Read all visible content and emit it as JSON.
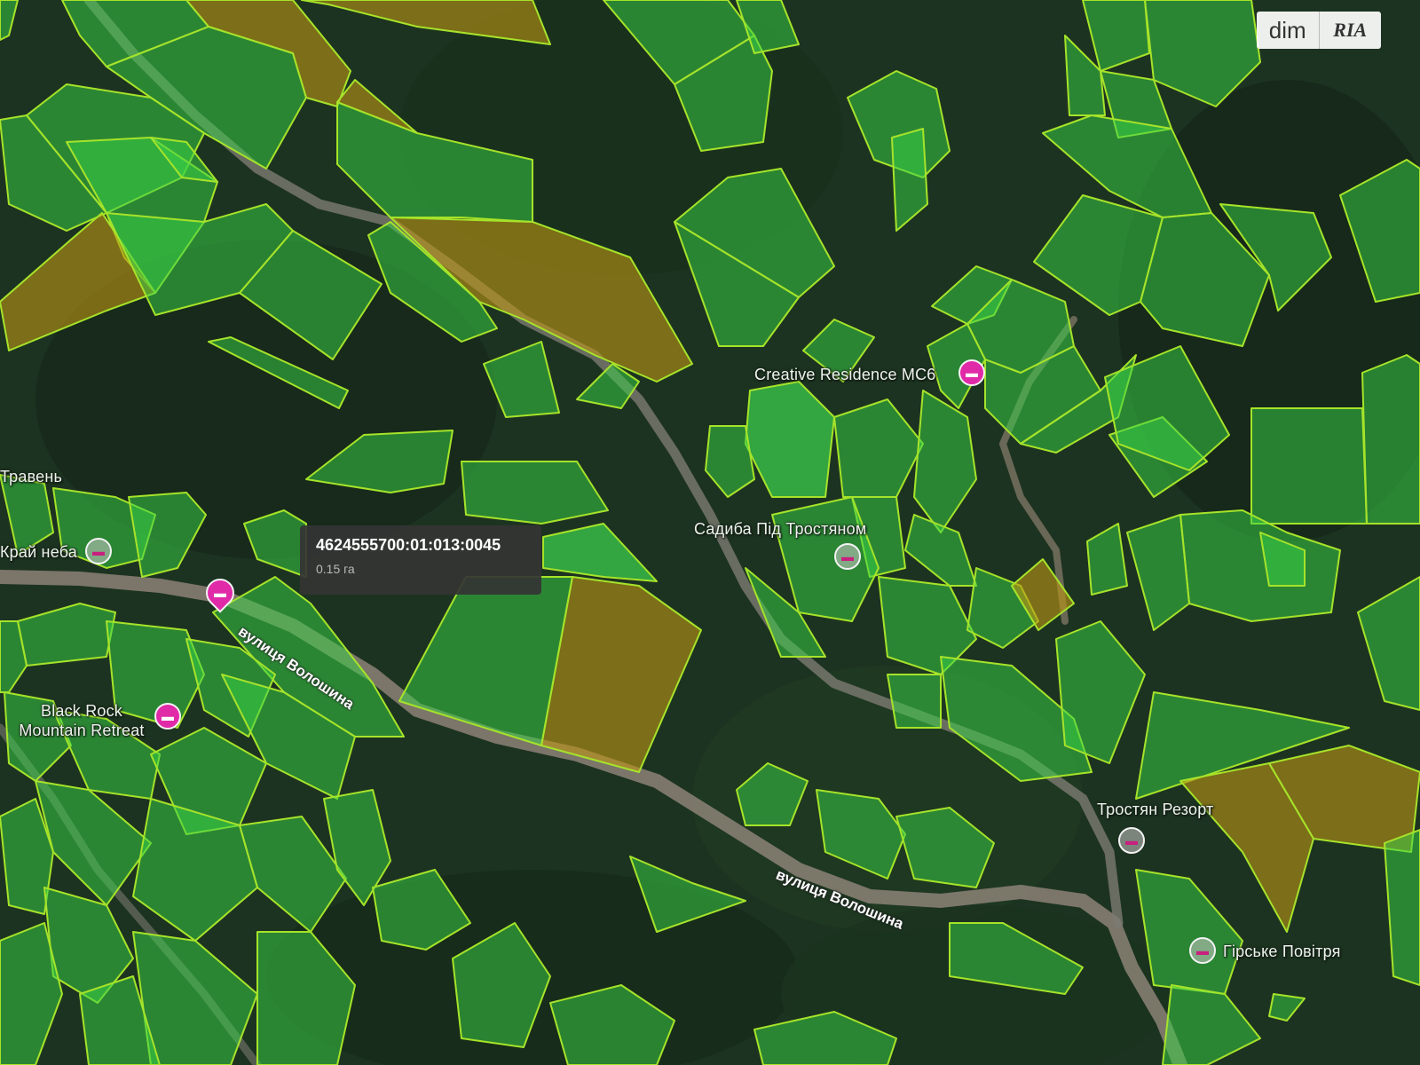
{
  "map": {
    "places": {
      "travnen": "Травень",
      "krai_neba": "Край неба",
      "black_rock": "Black Rock Mountain Retreat",
      "creative_residence": "Creative Residence MC6",
      "sadyba": "Садиба Під Тростяном",
      "trostian_resort": "Тростян Резорт",
      "hirske_povitria": "Гірське Повітря"
    },
    "streets": {
      "voloshyna_1": "вулиця Волошина",
      "voloshyna_2": "вулиця Волошина"
    },
    "icons": {
      "hotel": "hotel-bed-icon",
      "pin": "map-pin-icon"
    },
    "colors": {
      "parcel_green": "#3ad246",
      "parcel_olive": "#be9614",
      "parcel_outline": "#a6e32a",
      "hotel_pin": "#e02aa8",
      "road": "#8c8275"
    }
  },
  "tooltip": {
    "cadastral_number": "4624555700:01:013:0045",
    "area": "0.15 га"
  },
  "logo": {
    "brand_left": "dim",
    "brand_right": "RIA"
  }
}
